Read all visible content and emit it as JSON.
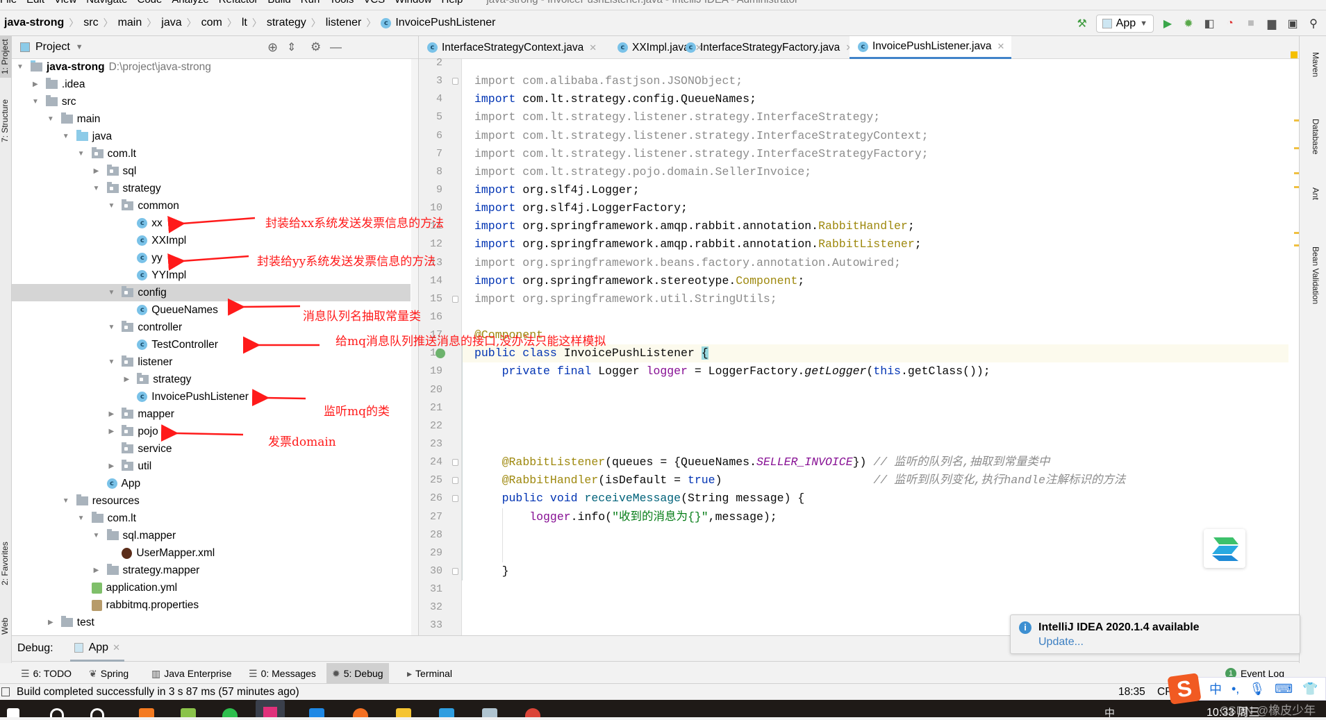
{
  "menubar": {
    "items": [
      "File",
      "Edit",
      "View",
      "Navigate",
      "Code",
      "Analyze",
      "Refactor",
      "Build",
      "Run",
      "Tools",
      "VCS",
      "Window",
      "Help"
    ],
    "title": "java-strong - InvoicePushListener.java - IntelliJ IDEA - Administrator"
  },
  "breadcrumb": [
    "java-strong",
    "src",
    "main",
    "java",
    "com",
    "lt",
    "strategy",
    "listener",
    "InvoicePushListener"
  ],
  "toolbar": {
    "run_config": "App",
    "icons": [
      "build-hammer-icon",
      "run-icon",
      "debug-icon",
      "coverage-icon",
      "profile-icon",
      "stop-icon",
      "project-structure-icon",
      "layout-icon",
      "search-icon"
    ]
  },
  "left_strip": [
    "1: Project",
    "7: Structure",
    "2: Favorites",
    "Web"
  ],
  "right_strip": [
    "Maven",
    "Database",
    "Ant",
    "Bean Validation"
  ],
  "project": {
    "title": "Project",
    "root_path": "D:\\project\\java-strong",
    "tree": [
      {
        "label": "java-strong",
        "level": 0,
        "type": "module",
        "state": "open"
      },
      {
        "label": ".idea",
        "level": 1,
        "type": "folder",
        "state": "closed"
      },
      {
        "label": "src",
        "level": 1,
        "type": "folder",
        "state": "open"
      },
      {
        "label": "main",
        "level": 2,
        "type": "folder",
        "state": "open"
      },
      {
        "label": "java",
        "level": 3,
        "type": "src",
        "state": "open"
      },
      {
        "label": "com.lt",
        "level": 4,
        "type": "pkg",
        "state": "open"
      },
      {
        "label": "sql",
        "level": 5,
        "type": "pkg",
        "state": "closed"
      },
      {
        "label": "strategy",
        "level": 5,
        "type": "pkg",
        "state": "open"
      },
      {
        "label": "common",
        "level": 6,
        "type": "pkg",
        "state": "open"
      },
      {
        "label": "xx",
        "level": 7,
        "type": "class"
      },
      {
        "label": "XXImpl",
        "level": 7,
        "type": "class"
      },
      {
        "label": "yy",
        "level": 7,
        "type": "class"
      },
      {
        "label": "YYImpl",
        "level": 7,
        "type": "class"
      },
      {
        "label": "config",
        "level": 6,
        "type": "pkg",
        "state": "open",
        "selected": true
      },
      {
        "label": "QueueNames",
        "level": 7,
        "type": "class"
      },
      {
        "label": "controller",
        "level": 6,
        "type": "pkg",
        "state": "open"
      },
      {
        "label": "TestController",
        "level": 7,
        "type": "class"
      },
      {
        "label": "listener",
        "level": 6,
        "type": "pkg",
        "state": "open"
      },
      {
        "label": "strategy",
        "level": 7,
        "type": "pkg",
        "state": "closed"
      },
      {
        "label": "InvoicePushListener",
        "level": 7,
        "type": "class"
      },
      {
        "label": "mapper",
        "level": 6,
        "type": "pkg",
        "state": "closed"
      },
      {
        "label": "pojo",
        "level": 6,
        "type": "pkg",
        "state": "closed"
      },
      {
        "label": "service",
        "level": 6,
        "type": "pkg"
      },
      {
        "label": "util",
        "level": 6,
        "type": "pkg",
        "state": "closed"
      },
      {
        "label": "App",
        "level": 5,
        "type": "app"
      },
      {
        "label": "resources",
        "level": 3,
        "type": "folder",
        "state": "open"
      },
      {
        "label": "com.lt",
        "level": 4,
        "type": "folder",
        "state": "open"
      },
      {
        "label": "sql.mapper",
        "level": 5,
        "type": "folder",
        "state": "open"
      },
      {
        "label": "UserMapper.xml",
        "level": 6,
        "type": "xml"
      },
      {
        "label": "strategy.mapper",
        "level": 5,
        "type": "folder",
        "state": "closed"
      },
      {
        "label": "application.yml",
        "level": 4,
        "type": "yml"
      },
      {
        "label": "rabbitmq.properties",
        "level": 4,
        "type": "props"
      },
      {
        "label": "test",
        "level": 2,
        "type": "folder",
        "state": "closed"
      }
    ]
  },
  "annotations": [
    {
      "text": "封装给xx系统发送发票信息的方法",
      "target": "xx"
    },
    {
      "text": "封装给yy系统发送发票信息的方法",
      "target": "yy"
    },
    {
      "text": "消息队列名抽取常量类",
      "target": "QueueNames"
    },
    {
      "text": "给mq消息队列推送消息的接口,没办法只能这样模拟",
      "target": "TestController"
    },
    {
      "text": "监听mq的类",
      "target": "InvoicePushListener"
    },
    {
      "text": "发票domain",
      "target": "pojo"
    }
  ],
  "annotation_color": "#ff1a1a",
  "tabs": [
    {
      "label": "InterfaceStrategyContext.java",
      "active": false
    },
    {
      "label": "XXImpl.java",
      "active": false
    },
    {
      "label": "InterfaceStrategyFactory.java",
      "active": false
    },
    {
      "label": "InvoicePushListener.java",
      "active": true
    }
  ],
  "code": {
    "first_line": 2,
    "current_line": 18,
    "lines": [
      [],
      [
        [
          "g",
          "import com.alibaba.fastjson.JSONObject;"
        ]
      ],
      [
        [
          "k",
          "import "
        ],
        [
          "",
          "com.lt.strategy.config.QueueNames;"
        ]
      ],
      [
        [
          "g",
          "import com.lt.strategy.listener.strategy.InterfaceStrategy;"
        ]
      ],
      [
        [
          "g",
          "import com.lt.strategy.listener.strategy.InterfaceStrategyContext;"
        ]
      ],
      [
        [
          "g",
          "import com.lt.strategy.listener.strategy.InterfaceStrategyFactory;"
        ]
      ],
      [
        [
          "g",
          "import com.lt.strategy.pojo.domain.SellerInvoice;"
        ]
      ],
      [
        [
          "k",
          "import "
        ],
        [
          "",
          "org.slf4j.Logger;"
        ]
      ],
      [
        [
          "k",
          "import "
        ],
        [
          "",
          "org.slf4j.LoggerFactory;"
        ]
      ],
      [
        [
          "k",
          "import "
        ],
        [
          "",
          "org.springframework.amqp.rabbit.annotation."
        ],
        [
          "a",
          "RabbitHandler"
        ],
        [
          "",
          ";"
        ]
      ],
      [
        [
          "k",
          "import "
        ],
        [
          "",
          "org.springframework.amqp.rabbit.annotation."
        ],
        [
          "a",
          "RabbitListener"
        ],
        [
          "",
          ";"
        ]
      ],
      [
        [
          "g",
          "import org.springframework.beans.factory.annotation.Autowired;"
        ]
      ],
      [
        [
          "k",
          "import "
        ],
        [
          "",
          "org.springframework.stereotype."
        ],
        [
          "a",
          "Component"
        ],
        [
          "",
          ";"
        ]
      ],
      [
        [
          "g",
          "import org.springframework.util.StringUtils;"
        ]
      ],
      [],
      [
        [
          "a",
          "@Component"
        ]
      ],
      [
        [
          "k",
          "public class "
        ],
        [
          "",
          "InvoicePushListener "
        ],
        [
          "brace",
          "{"
        ]
      ],
      [
        [
          "",
          "    "
        ],
        [
          "k",
          "private final "
        ],
        [
          "",
          "Logger "
        ],
        [
          "f",
          "logger"
        ],
        [
          "",
          " = LoggerFactory."
        ],
        [
          "i",
          "getLogger"
        ],
        [
          "",
          "("
        ],
        [
          "k",
          "this"
        ],
        [
          "",
          ".getClass());"
        ]
      ],
      [],
      [],
      [],
      [],
      [
        [
          "",
          "    "
        ],
        [
          "a",
          "@RabbitListener"
        ],
        [
          "",
          "(queues = {QueueNames."
        ],
        [
          "fi",
          "SELLER_INVOICE"
        ],
        [
          "",
          "}) "
        ],
        [
          "c",
          "// 监听的队列名,抽取到常量类中"
        ]
      ],
      [
        [
          "",
          "    "
        ],
        [
          "a",
          "@RabbitHandler"
        ],
        [
          "",
          "(isDefault = "
        ],
        [
          "k",
          "true"
        ],
        [
          "",
          ")                      "
        ],
        [
          "c",
          "// 监听到队列变化,执行handle注解标识的方法"
        ]
      ],
      [
        [
          "",
          "    "
        ],
        [
          "k",
          "public void "
        ],
        [
          "m",
          "receiveMessage"
        ],
        [
          "",
          "(String message) {"
        ]
      ],
      [
        [
          "",
          "        "
        ],
        [
          "f",
          "logger"
        ],
        [
          "",
          ".info("
        ],
        [
          "s",
          "\"收到的消息为{}\""
        ],
        [
          "",
          ",message);"
        ]
      ],
      [],
      [],
      [
        [
          "",
          "    }"
        ]
      ],
      [],
      [],
      []
    ]
  },
  "debug": {
    "label": "Debug:",
    "tab": "App"
  },
  "toolwindows": [
    {
      "label": "6: TODO",
      "icon": "list-icon"
    },
    {
      "label": "Spring",
      "icon": "spring-leaf-icon"
    },
    {
      "label": "Java Enterprise",
      "icon": "java-enterprise-icon"
    },
    {
      "label": "0: Messages",
      "icon": "messages-icon"
    },
    {
      "label": "5: Debug",
      "icon": "bug-icon",
      "active": true
    },
    {
      "label": "Terminal",
      "icon": "terminal-icon"
    }
  ],
  "event_log": {
    "label": "Event Log",
    "count": "1"
  },
  "status": {
    "message": "Build completed successfully in 3 s 87 ms (57 minutes ago)",
    "position": "18:35",
    "line_sep": "CRL"
  },
  "notification": {
    "title": "IntelliJ IDEA 2020.1.4 available",
    "link": "Update..."
  },
  "ime": {
    "lang": "中",
    "punct": "•,"
  },
  "taskbar": {
    "clock": "10:33 周三",
    "watermark": "CSDN @橡皮少年",
    "ime_indicator": "中"
  }
}
